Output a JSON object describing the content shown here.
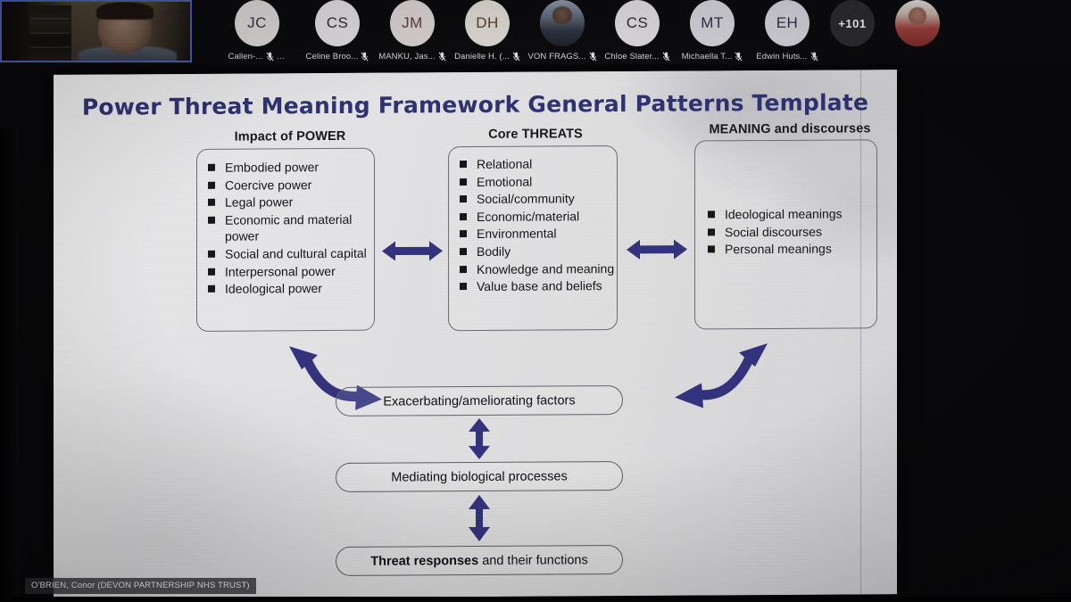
{
  "meeting": {
    "self_view": {
      "label": "self-video"
    },
    "participants": [
      {
        "initials": "JC",
        "name": "Callen-...",
        "avatar_kind": "initials",
        "tint": "tint-a",
        "muted": true,
        "more": true
      },
      {
        "initials": "CS",
        "name": "Celine Broo...",
        "avatar_kind": "initials",
        "tint": "tint-b",
        "muted": true,
        "more": false
      },
      {
        "initials": "JM",
        "name": "MANKU, Jas...",
        "avatar_kind": "initials",
        "tint": "tint-c",
        "muted": true,
        "more": false
      },
      {
        "initials": "DH",
        "name": "Danielle H. (...",
        "avatar_kind": "initials",
        "tint": "tint-d",
        "muted": true,
        "more": false
      },
      {
        "initials": "",
        "name": "VON FRAGS...",
        "avatar_kind": "photo-m",
        "tint": "",
        "muted": true,
        "more": false
      },
      {
        "initials": "CS",
        "name": "Chloe Slater...",
        "avatar_kind": "initials",
        "tint": "tint-b",
        "muted": true,
        "more": false
      },
      {
        "initials": "MT",
        "name": "Michaella T...",
        "avatar_kind": "initials",
        "tint": "tint-e",
        "muted": true,
        "more": false
      },
      {
        "initials": "EH",
        "name": "Edwin Huts...",
        "avatar_kind": "initials",
        "tint": "tint-e",
        "muted": true,
        "more": false
      },
      {
        "initials": "+101",
        "name": "",
        "avatar_kind": "overflow",
        "tint": "",
        "muted": false,
        "more": false
      },
      {
        "initials": "",
        "name": "",
        "avatar_kind": "photo-f",
        "tint": "",
        "muted": false,
        "more": false
      }
    ],
    "presenter_chip": "O'BRIEN, Conor (DEVON PARTNERSHIP NHS TRUST)"
  },
  "slide": {
    "title": "Power Threat Meaning Framework General Patterns Template",
    "title_color": "#2e3270",
    "arrow_color": "#33337d",
    "columns": [
      {
        "heading": "Impact of POWER",
        "items": [
          "Embodied power",
          "Coercive power",
          "Legal power",
          "Economic and material power",
          "Social and cultural capital",
          "Interpersonal power",
          "Ideological power"
        ]
      },
      {
        "heading": "Core THREATS",
        "items": [
          "Relational",
          "Emotional",
          "Social/community",
          "Economic/material",
          "Environmental",
          "Bodily",
          "Knowledge and meaning",
          "Value base and beliefs"
        ]
      },
      {
        "heading": "MEANING and discourses",
        "items": [
          "Ideological meanings",
          "Social discourses",
          "Personal meanings"
        ]
      }
    ],
    "flow": [
      {
        "text_bold": "",
        "text": "Exacerbating/ameliorating factors"
      },
      {
        "text_bold": "",
        "text": "Mediating biological processes"
      },
      {
        "text_bold": "Threat responses",
        "text": " and their functions"
      }
    ]
  }
}
